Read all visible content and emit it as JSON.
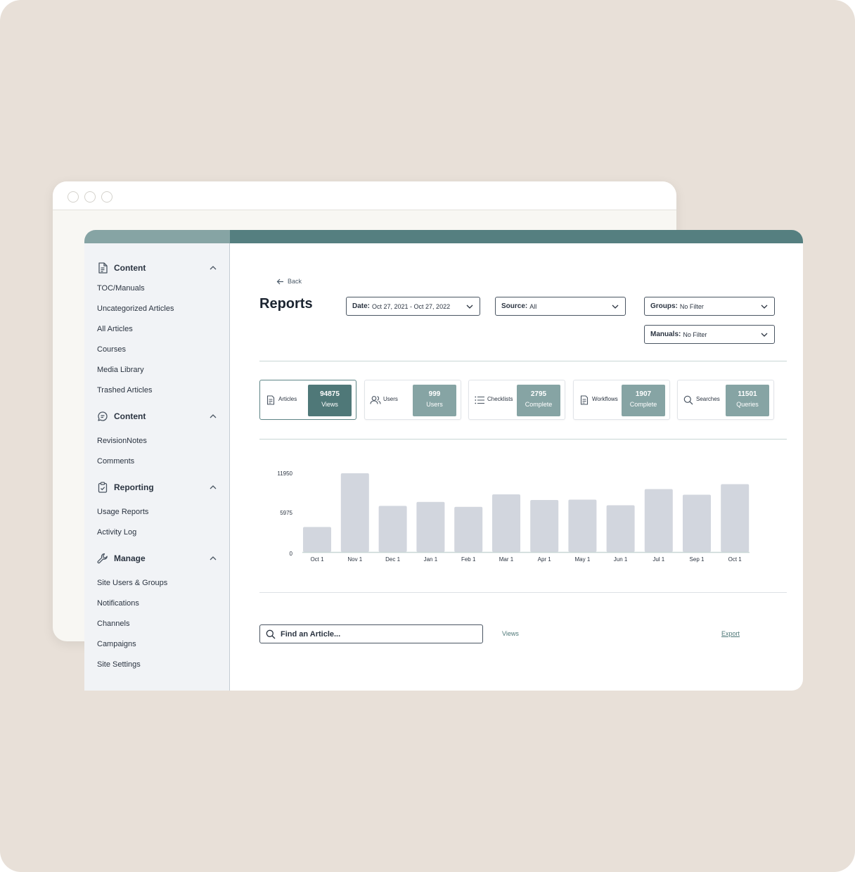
{
  "browser": {
    "window_controls": [
      "circle",
      "circle",
      "circle"
    ]
  },
  "sidebar": {
    "sections": [
      {
        "label": "Content",
        "icon": "document-icon",
        "items": [
          "TOC/Manuals",
          "Uncategorized Articles",
          "All Articles",
          "Courses",
          "Media Library",
          "Trashed Articles"
        ]
      },
      {
        "label": "Content",
        "icon": "chat-bubble-icon",
        "items": [
          "RevisionNotes",
          "Comments"
        ]
      },
      {
        "label": "Reporting",
        "icon": "clipboard-check-icon",
        "items": [
          "Usage Reports",
          "Activity Log"
        ]
      },
      {
        "label": "Manage",
        "icon": "wrench-icon",
        "items": [
          "Site Users & Groups",
          "Notifications",
          "Channels",
          "Campaigns",
          "Site Settings"
        ]
      }
    ]
  },
  "header": {
    "back_label": "Back",
    "title": "Reports"
  },
  "filters": {
    "date": {
      "label": "Date:",
      "value": "Oct 27, 2021 - Oct 27, 2022"
    },
    "source": {
      "label": "Source:",
      "value": "All"
    },
    "groups": {
      "label": "Groups:",
      "value": "No Filter"
    },
    "manuals": {
      "label": "Manuals:",
      "value": "No Filter"
    }
  },
  "stats": [
    {
      "label": "Articles",
      "icon": "document-icon",
      "value": "94875",
      "unit": "Views",
      "active": true
    },
    {
      "label": "Users",
      "icon": "users-icon",
      "value": "999",
      "unit": "Users",
      "active": false
    },
    {
      "label": "Checklists",
      "icon": "list-icon",
      "value": "2795",
      "unit": "Complete",
      "active": false
    },
    {
      "label": "Workflows",
      "icon": "document-icon",
      "value": "1907",
      "unit": "Complete",
      "active": false
    },
    {
      "label": "Searches",
      "icon": "search-icon",
      "value": "11501",
      "unit": "Queries",
      "active": false
    }
  ],
  "chart_data": {
    "type": "bar",
    "categories": [
      "Oct 1",
      "Nov 1",
      "Dec 1",
      "Jan 1",
      "Feb 1",
      "Mar 1",
      "Apr 1",
      "May 1",
      "Jun 1",
      "Jul 1",
      "Sep 1",
      "Oct 1"
    ],
    "values": [
      3800,
      11950,
      7000,
      7600,
      6850,
      8750,
      7900,
      7950,
      7100,
      9550,
      8700,
      10300
    ],
    "yticks": [
      "11950",
      "5975",
      "0"
    ],
    "ylim": [
      0,
      11950
    ],
    "grid": false,
    "bar_color": "#d2d6de",
    "axis_color": "#c8d6d5"
  },
  "bottom": {
    "search_placeholder": "Find an Article...",
    "views_label": "Views",
    "export_label": "Export"
  },
  "colors": {
    "accent": "#557f80",
    "accent_light": "#86a4a4",
    "accent_dark": "#4f7878"
  }
}
